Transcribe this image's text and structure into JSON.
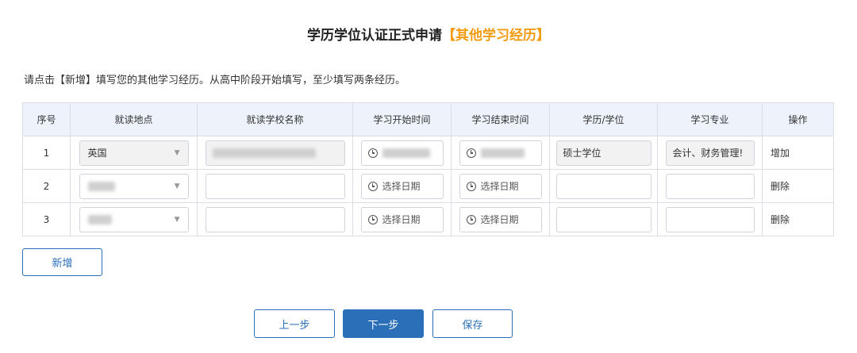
{
  "header": {
    "title": "学历学位认证正式申请",
    "subtitle": "【其他学习经历】"
  },
  "hint": "请点击【新增】填写您的其他学习经历。从高中阶段开始填写，至少填写两条经历。",
  "table": {
    "columns": [
      "序号",
      "就读地点",
      "就读学校名称",
      "学习开始时间",
      "学习结束时间",
      "学历/学位",
      "学习专业",
      "操作"
    ],
    "rows": [
      {
        "index": "1",
        "location": "英国",
        "school": "",
        "start": "",
        "end": "",
        "degree": "硕士学位",
        "major": "会计、财务管理!",
        "action": "增加"
      },
      {
        "index": "2",
        "location": "",
        "school": "",
        "start": "选择日期",
        "end": "选择日期",
        "degree": "",
        "major": "",
        "action": "删除"
      },
      {
        "index": "3",
        "location": "",
        "school": "",
        "start": "选择日期",
        "end": "选择日期",
        "degree": "",
        "major": "",
        "action": "删除"
      }
    ]
  },
  "buttons": {
    "add": "新增",
    "prev": "上一步",
    "next": "下一步",
    "save": "保存"
  },
  "icons": {
    "clock": "clock-icon",
    "dropdown": "chevron-down-icon"
  },
  "colors": {
    "primary": "#2a6fb8",
    "accent": "#f39c12",
    "header_bg": "#eef3fb"
  }
}
